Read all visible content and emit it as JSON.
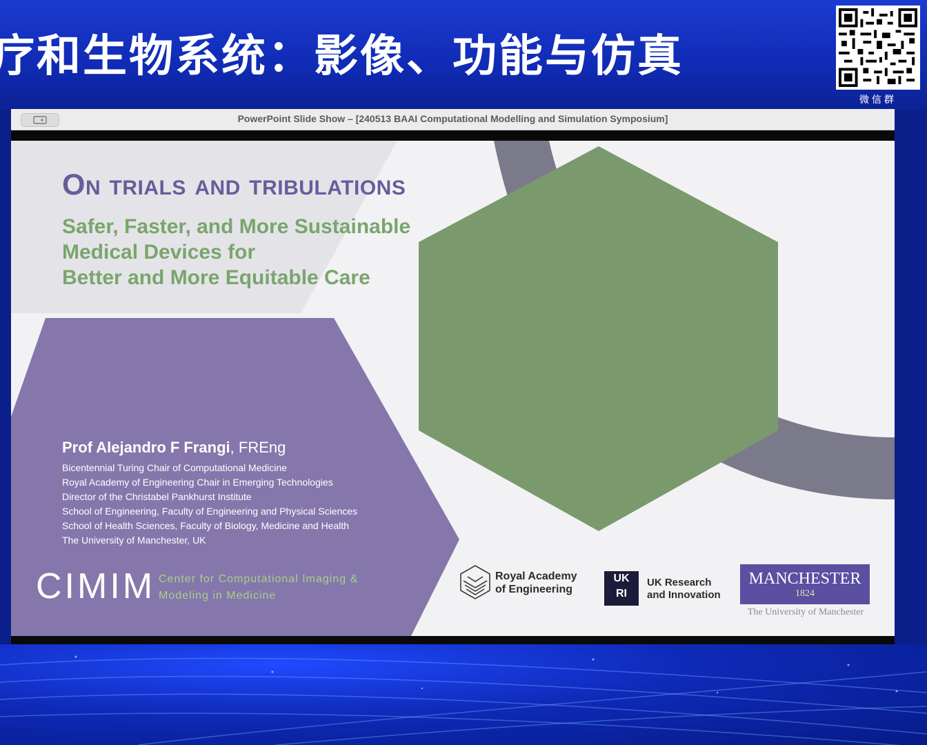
{
  "banner": {
    "title": "疗和生物系统：影像、功能与仿真",
    "qr_caption": "微信群"
  },
  "window": {
    "title": "PowerPoint Slide Show – [240513 BAAI Computational Modelling and Simulation Symposium]",
    "presenter_icon": "presenter-view-icon"
  },
  "slide": {
    "title": "On trials and tribulations",
    "subtitle_lines": [
      "Safer, Faster, and More Sustainable",
      "Medical Devices for",
      "Better and More Equitable Care"
    ],
    "author": {
      "name": "Prof Alejandro F Frangi",
      "suffix": ", FREng"
    },
    "affiliations": [
      "Bicentennial Turing Chair of Computational Medicine",
      "Royal Academy of Engineering Chair in Emerging Technologies",
      "Director of the Christabel Pankhurst Institute",
      "School of Engineering, Faculty of Engineering and Physical Sciences",
      "School of Health Sciences, Faculty of Biology, Medicine and Health",
      "The University of Manchester, UK"
    ],
    "cimim": {
      "logo": "CIMIM",
      "lines": [
        "Center for Computational Imaging &",
        "Modeling in Medicine"
      ]
    },
    "logos": {
      "rae": [
        "Royal Academy",
        "of Engineering"
      ],
      "ukri_mark": [
        "UK",
        "RI"
      ],
      "ukri": [
        "UK Research",
        "and Innovation"
      ],
      "manchester": "MANCHESTER",
      "manchester_year": "1824",
      "manchester_sub": "The University of Manchester"
    },
    "colors": {
      "purple": "#8577ab",
      "green": "#7a9a6e",
      "title_purple": "#6a5b9c",
      "subtitle_green": "#7aa56d"
    }
  }
}
